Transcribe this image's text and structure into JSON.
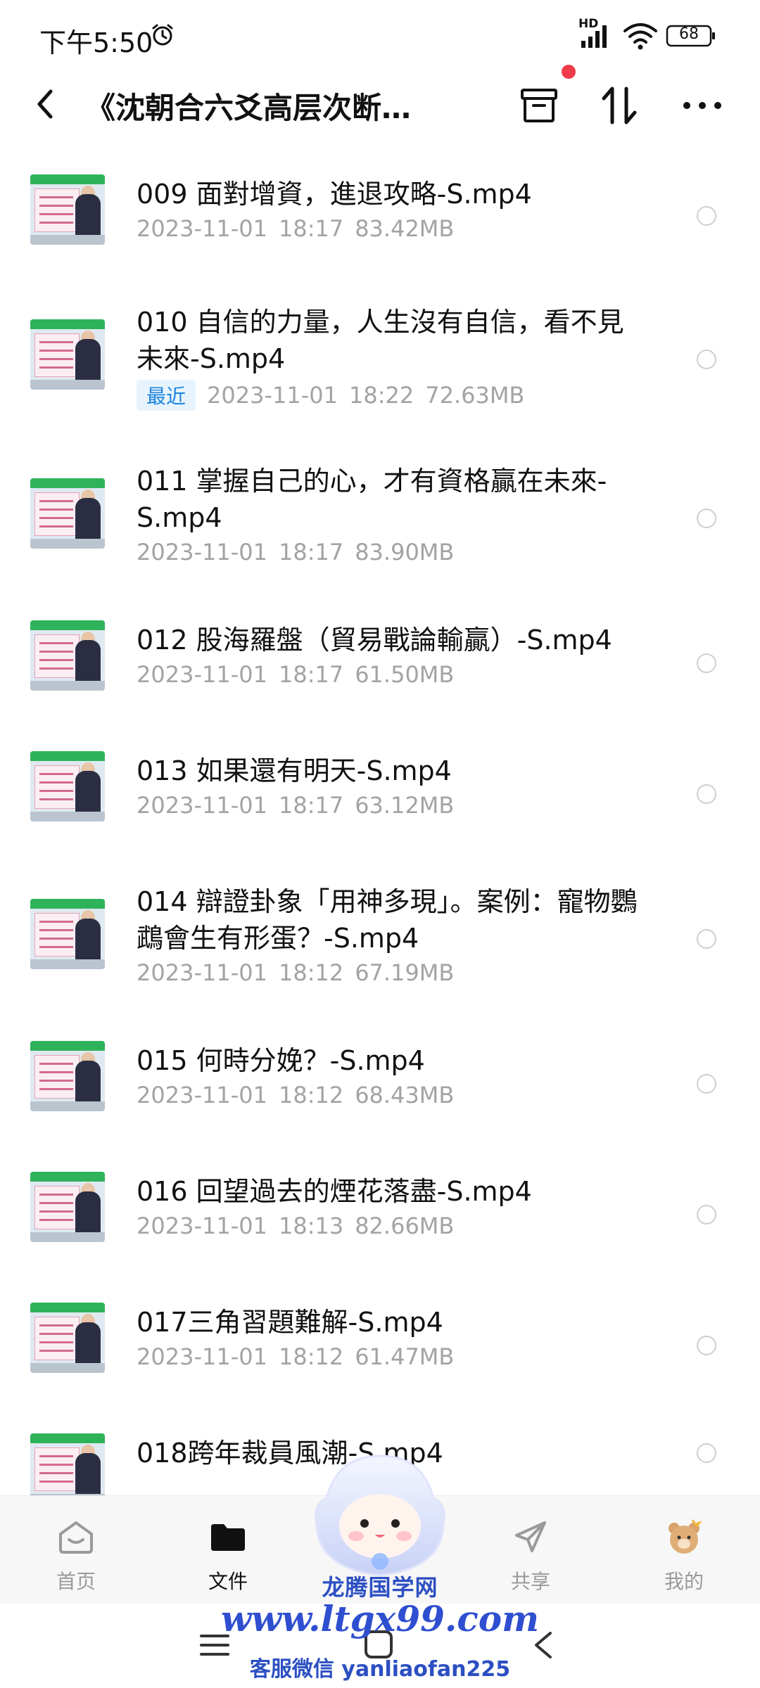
{
  "status_bar": {
    "time": "下午5:50",
    "network_label": "HD",
    "battery": "68"
  },
  "header": {
    "title": "《沈朝合六爻高层次断…",
    "back_icon": "back-chevron-icon",
    "archive_icon": "archive-box-icon",
    "sort_icon": "sort-arrows-icon",
    "more_icon": "more-dots-icon",
    "notification_color": "#ef3b4a"
  },
  "files": [
    {
      "name": "009 面對增資，進退攻略-S.mp4",
      "date": "2023-11-01",
      "time": "18:17",
      "size": "83.42MB",
      "tag": ""
    },
    {
      "name": "010 自信的力量，人生沒有自信，看不見未來-S.mp4",
      "date": "2023-11-01",
      "time": "18:22",
      "size": "72.63MB",
      "tag": "最近"
    },
    {
      "name": "011 掌握自己的心，才有資格贏在未來-S.mp4",
      "date": "2023-11-01",
      "time": "18:17",
      "size": "83.90MB",
      "tag": ""
    },
    {
      "name": "012 股海羅盤（貿易戰論輸贏）-S.mp4",
      "date": "2023-11-01",
      "time": "18:17",
      "size": "61.50MB",
      "tag": ""
    },
    {
      "name": "013 如果還有明天-S.mp4",
      "date": "2023-11-01",
      "time": "18:17",
      "size": "63.12MB",
      "tag": ""
    },
    {
      "name": "014 辯證卦象「用神多現」。案例：寵物鸚鵡會生有形蛋？-S.mp4",
      "date": "2023-11-01",
      "time": "18:12",
      "size": "67.19MB",
      "tag": ""
    },
    {
      "name": "015 何時分娩？-S.mp4",
      "date": "2023-11-01",
      "time": "18:12",
      "size": "68.43MB",
      "tag": ""
    },
    {
      "name": "016 回望過去的煙花落盡-S.mp4",
      "date": "2023-11-01",
      "time": "18:13",
      "size": "82.66MB",
      "tag": ""
    },
    {
      "name": "017三角習題難解-S.mp4",
      "date": "2023-11-01",
      "time": "18:12",
      "size": "61.47MB",
      "tag": ""
    },
    {
      "name": "018跨年裁員風潮-S.mp4",
      "date": "",
      "time": "",
      "size": "",
      "tag": ""
    }
  ],
  "bottom_nav": [
    {
      "label": "首页",
      "icon": "home-face-icon",
      "active": false
    },
    {
      "label": "文件",
      "icon": "folder-icon",
      "active": true
    },
    {
      "label": "",
      "icon": "mascot-icon",
      "active": false
    },
    {
      "label": "共享",
      "icon": "send-icon",
      "active": false
    },
    {
      "label": "我的",
      "icon": "bear-avatar-icon",
      "active": false
    }
  ],
  "system_nav": {
    "menu_icon": "menu-lines-icon",
    "home_icon": "home-square-icon",
    "back_icon": "back-chevron-icon"
  },
  "watermark": {
    "title": "龙腾国学网",
    "url": "www.ltgx99.com",
    "contact": "客服微信 yanliaofan225"
  }
}
